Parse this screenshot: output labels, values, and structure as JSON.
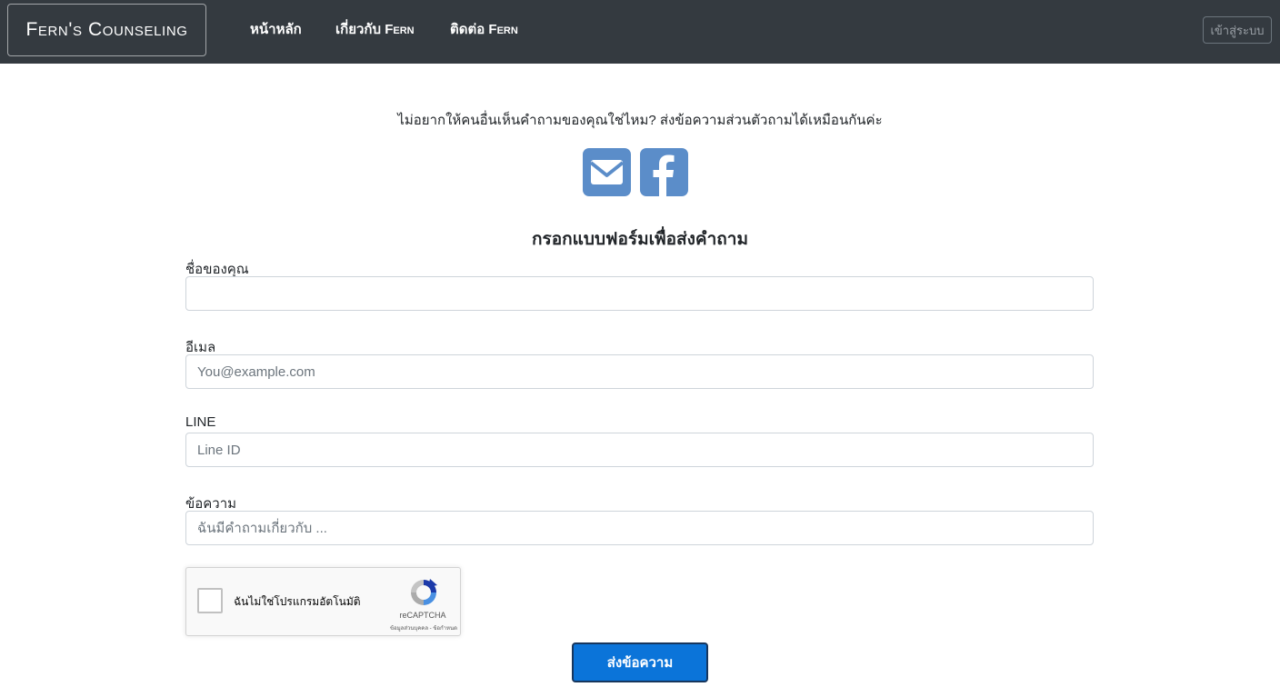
{
  "header": {
    "brand": "Fern's Counseling",
    "nav": [
      {
        "label": "หน้าหลัก"
      },
      {
        "label": "เกี่ยวกับ Fern"
      },
      {
        "label": "ติดต่อ Fern"
      }
    ],
    "login_label": "เข้าสู่ระบบ",
    "background": "#343a40"
  },
  "main": {
    "intro": "ไม่อยากให้คนอื่นเห็นคำถามของคุณใช่ไหม? ส่งข้อความส่วนตัวถามได้เหมือนกันค่ะ",
    "social": [
      {
        "icon": "envelope-icon",
        "color": "#5b8dc9"
      },
      {
        "icon": "facebook-icon",
        "color": "#5b8dc9"
      }
    ],
    "form_title": "กรอกแบบฟอร์มเพื่อส่งคำถาม",
    "fields": {
      "name": {
        "label": "ชื่อของคุณ",
        "value": "",
        "placeholder": ""
      },
      "email": {
        "label": "อีเมล",
        "value": "",
        "placeholder": "You@example.com"
      },
      "line": {
        "label": "LINE",
        "value": "",
        "placeholder": "Line ID"
      },
      "message": {
        "label": "ข้อความ",
        "value": "",
        "placeholder": "ฉันมีคำถามเกี่ยวกับ ..."
      }
    },
    "captcha": {
      "label": "ฉันไม่ใช่โปรแกรมอัตโนมัติ",
      "brand": "reCAPTCHA",
      "links": "ข้อมูลส่วนบุคคล - ข้อกำหนด"
    },
    "submit_label": "ส่งข้อความ",
    "submit_color": "#0b74d9"
  }
}
